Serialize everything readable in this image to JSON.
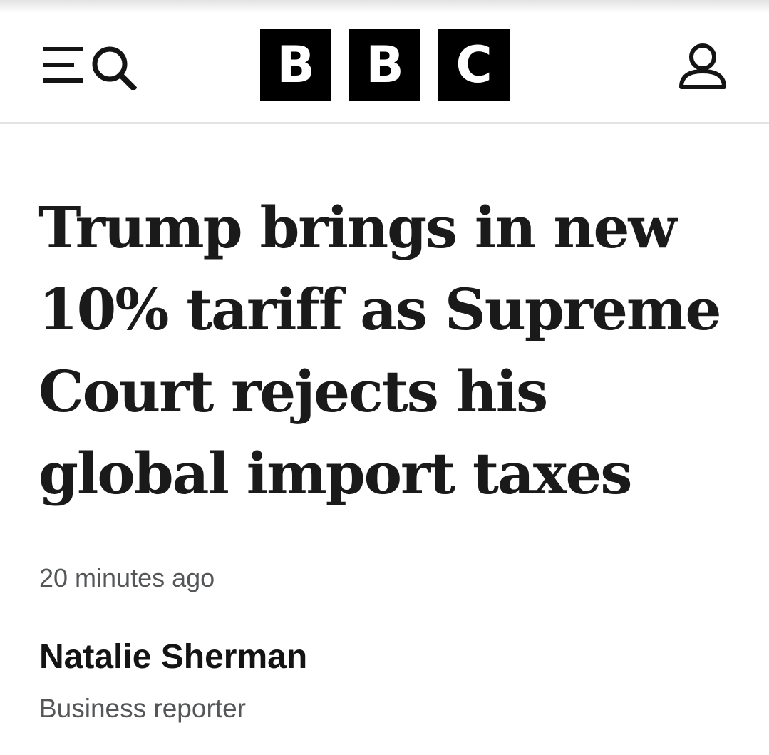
{
  "header": {
    "logo_letters": [
      "B",
      "B",
      "C"
    ],
    "icons": {
      "menu": "menu-icon",
      "search": "search-icon",
      "account": "account-icon"
    }
  },
  "article": {
    "headline": "Trump brings in new 10% tariff as Supreme Court rejects his global import taxes",
    "timestamp": "20 minutes ago",
    "author": {
      "name": "Natalie Sherman",
      "role": "Business reporter"
    }
  },
  "colors": {
    "logo_background": "#000000",
    "logo_text": "#ffffff",
    "headline_text": "#1a1a1a",
    "secondary_text": "#545658",
    "divider": "#e4e4e4"
  }
}
